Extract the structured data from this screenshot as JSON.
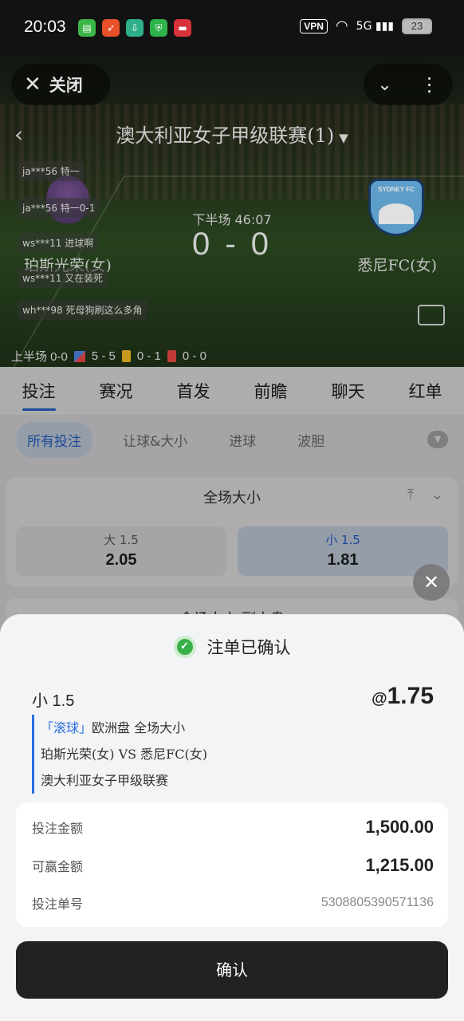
{
  "status_bar": {
    "time": "20:03",
    "vpn": "VPN",
    "network": "5G",
    "battery": "23"
  },
  "top_bar": {
    "close_label": "关闭"
  },
  "match": {
    "league_title": "澳大利亚女子甲级联赛(1)",
    "home_team": "珀斯光荣(女)",
    "away_team": "悉尼FC(女)",
    "period_time": "下半场 46:07",
    "score": "0 - 0",
    "first_half_stats": "上半场 0-0",
    "corners": "5 - 5",
    "yellow_cards": "0 - 1",
    "red_cards": "0 - 0",
    "away_logo_text": "SYDNEY FC"
  },
  "comments": [
    "ja***56 特一",
    "ja***56 特一0-1",
    "ws***11 进球啊",
    "ws***11 又在装死",
    "wh***98 死母狗刷这么多角"
  ],
  "tabs": [
    "投注",
    "赛况",
    "首发",
    "前瞻",
    "聊天",
    "红单"
  ],
  "filters": [
    "所有投注",
    "让球&大小",
    "进球",
    "波胆"
  ],
  "market": {
    "title": "全场大小",
    "over_label": "大  1.5",
    "over_odds": "2.05",
    "under_label": "小  1.5",
    "under_odds": "1.81",
    "next_title": "全场大小·副大盘"
  },
  "sheet": {
    "header": "注单已确认",
    "selection": "小 1.5",
    "odds_prefix": "@",
    "odds": "1.75",
    "live_tag": "「滚球」",
    "market_line": "欧洲盘  全场大小",
    "teams_line": "珀斯光荣(女) VS  悉尼FC(女)",
    "league_line": "澳大利亚女子甲级联赛",
    "stake_label": "投注金额",
    "stake_value": "1,500.00",
    "win_label": "可赢金额",
    "win_value": "1,215.00",
    "bet_id_label": "投注单号",
    "bet_id_value": "5308805390571136",
    "confirm_label": "确认"
  },
  "colors": {
    "accent": "#2a6ee0",
    "success": "#38b04a",
    "button_dark": "#222222"
  }
}
